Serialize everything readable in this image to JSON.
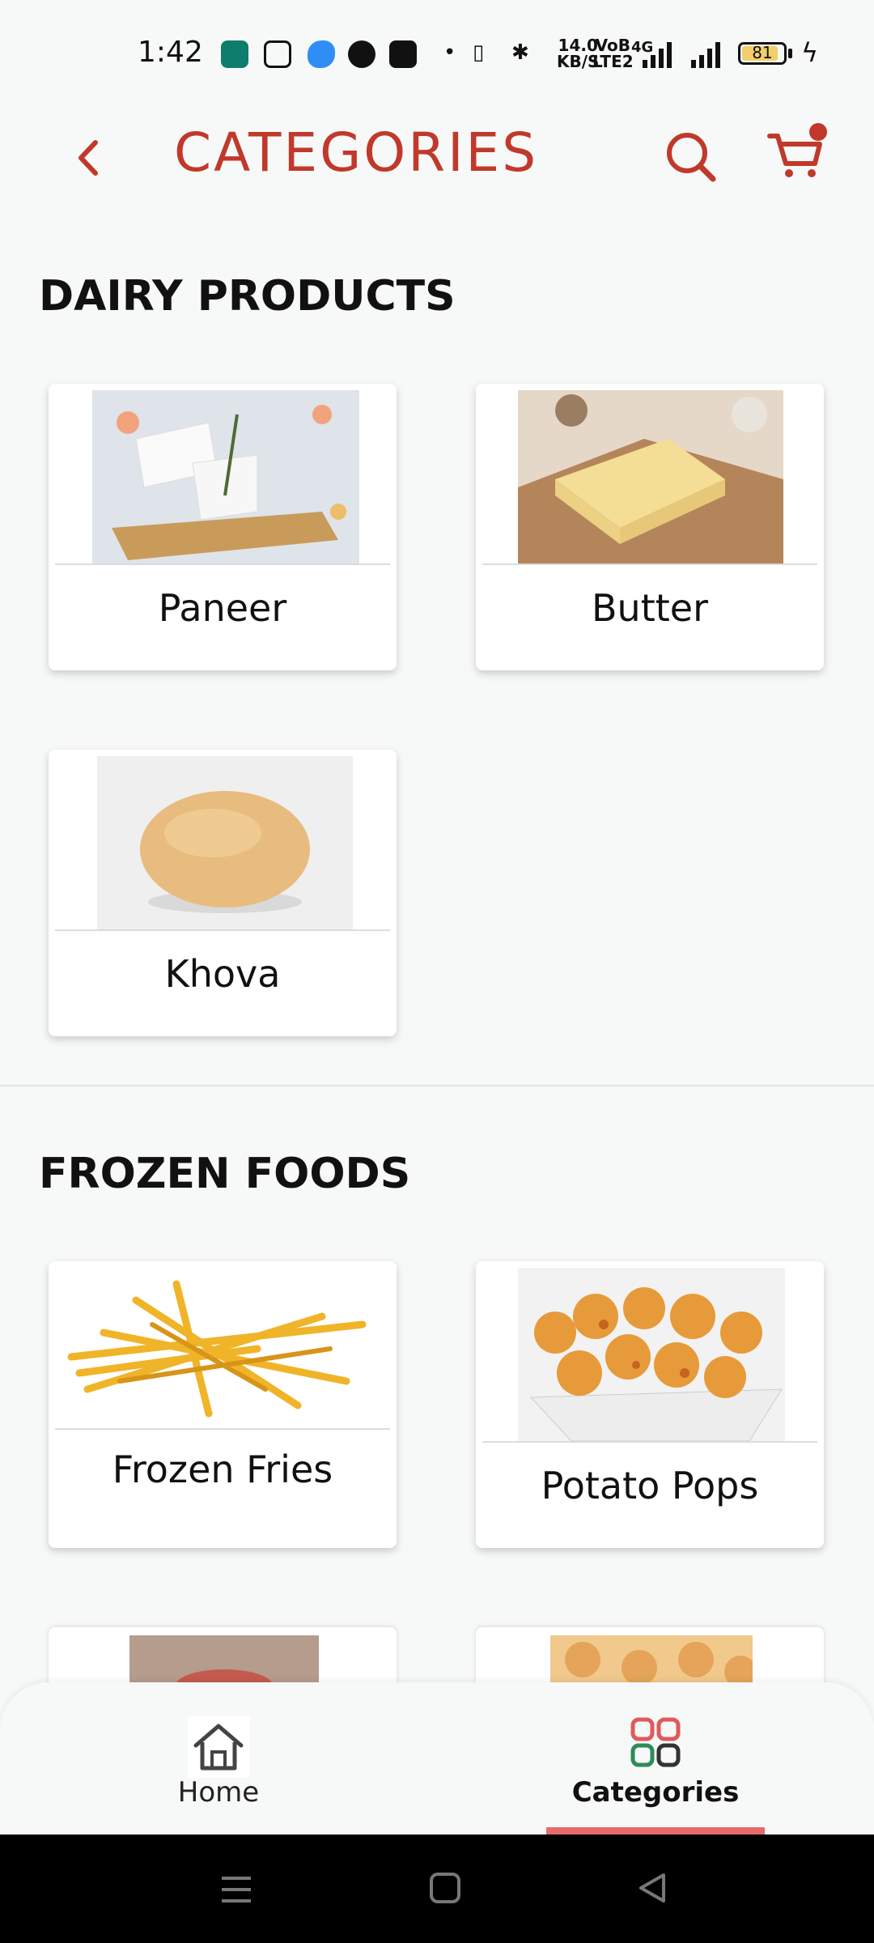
{
  "status_bar": {
    "time": "1:42",
    "network_speed": [
      "14.0",
      "KB/S"
    ],
    "volte": [
      "VoB",
      "LTE2"
    ],
    "signal": "4G",
    "battery": "81"
  },
  "header": {
    "title": "CATEGORIES",
    "accent_color": "#c0392b"
  },
  "sections": [
    {
      "title": "DAIRY PRODUCTS",
      "items": [
        {
          "label": "Paneer"
        },
        {
          "label": "Butter"
        },
        {
          "label": "Khova"
        }
      ]
    },
    {
      "title": "FROZEN FOODS",
      "items": [
        {
          "label": "Frozen Fries"
        },
        {
          "label": "Potato Pops"
        }
      ]
    }
  ],
  "bottom_nav": {
    "items": [
      {
        "label": "Home",
        "icon": "home-icon"
      },
      {
        "label": "Categories",
        "icon": "grid-icon"
      }
    ],
    "active": "Categories",
    "indicator_color": "#e86a6a"
  }
}
